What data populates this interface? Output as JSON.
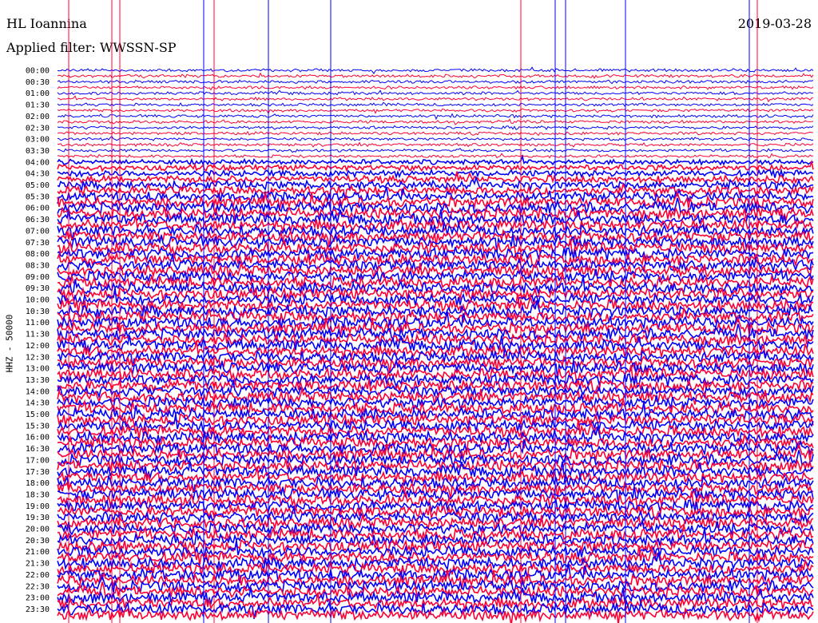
{
  "header": {
    "station": "HL Ioannina",
    "filter": "Applied filter: WWSSN-SP",
    "date": "2019-03-28"
  },
  "chart_data": {
    "type": "line",
    "title": "HL Ioannina",
    "subtitle": "Applied filter: WWSSN-SP",
    "ylabel": "HHZ - 50000",
    "xlabel": "",
    "tick_labels": [
      "00:00",
      "00:30",
      "01:00",
      "01:30",
      "02:00",
      "02:30",
      "03:00",
      "03:30",
      "04:00",
      "04:30",
      "05:00",
      "05:30",
      "06:00",
      "06:30",
      "07:00",
      "07:30",
      "08:00",
      "08:30",
      "09:00",
      "09:30",
      "10:00",
      "10:30",
      "11:00",
      "11:30",
      "12:00",
      "12:30",
      "13:00",
      "13:30",
      "14:00",
      "14:30",
      "15:00",
      "15:30",
      "16:00",
      "16:30",
      "17:00",
      "17:30",
      "18:00",
      "18:30",
      "19:00",
      "19:30",
      "20:00",
      "20:30",
      "21:00",
      "21:30",
      "22:00",
      "22:30",
      "23:00",
      "23:30"
    ],
    "trace_colors": [
      "#0000ff",
      "#ff0033"
    ],
    "grid": false,
    "legend": "none"
  }
}
